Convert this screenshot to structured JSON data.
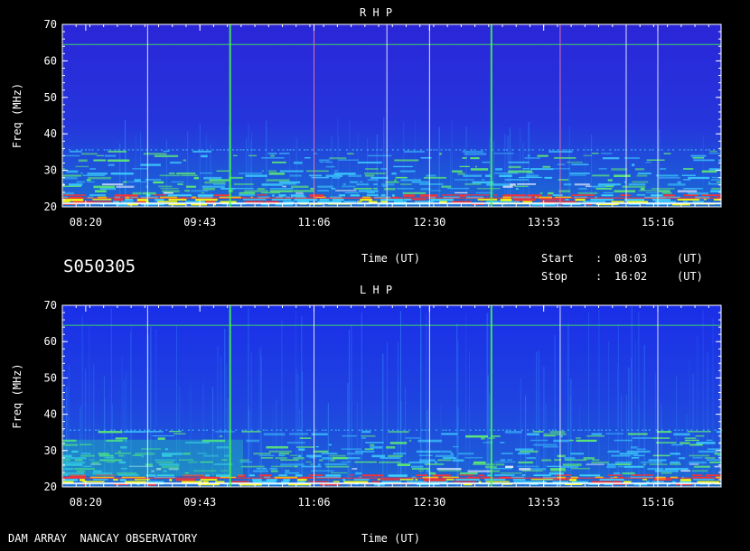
{
  "footer": {
    "observatory": "DAM ARRAY  NANCAY OBSERVATORY",
    "time_label": "Time (UT)"
  },
  "header_info": {
    "observation_id": "S050305",
    "time_label": "Time (UT)",
    "start_label": "Start",
    "start_value": "08:03",
    "stop_label": "Stop",
    "stop_value": "16:02",
    "separator": ":",
    "unit": "(UT)"
  },
  "colors": {
    "background": "#000000",
    "spectrum_base": "#1a24e0",
    "spectrum_high": "#2a4bd0",
    "noise_cyan": "#3fd6ff",
    "noise_green": "#66ff66",
    "hot_red": "#ff3030",
    "hot_yellow": "#ffff00",
    "green_marker": "#44ff44"
  },
  "chart_data": [
    {
      "type": "heatmap",
      "title": "R H P",
      "ylabel": "Freq (MHz)",
      "xlabel": "",
      "ylim": [
        20,
        70
      ],
      "y_ticks": [
        "20",
        "30",
        "40",
        "50",
        "60",
        "70"
      ],
      "y_tick_values": [
        20,
        30,
        40,
        50,
        60,
        70
      ],
      "xlim": [
        "08:03",
        "16:02"
      ],
      "x_ticks": [
        "08:20",
        "09:43",
        "11:06",
        "12:30",
        "13:53",
        "15:16"
      ],
      "x_tick_times": [
        "08:20",
        "09:43",
        "11:06",
        "12:30",
        "13:53",
        "15:16"
      ],
      "vertical_markers": [
        {
          "time": "09:05",
          "color": "white"
        },
        {
          "time": "10:05",
          "color": "green"
        },
        {
          "time": "11:06",
          "color": "pink"
        },
        {
          "time": "11:59",
          "color": "white"
        },
        {
          "time": "12:30",
          "color": "white"
        },
        {
          "time": "13:15",
          "color": "green"
        },
        {
          "time": "14:05",
          "color": "pink"
        },
        {
          "time": "14:53",
          "color": "white"
        },
        {
          "time": "15:16",
          "color": "white"
        }
      ],
      "horizontal_lines": [
        {
          "freq": 64.5,
          "color": "green"
        }
      ]
    },
    {
      "type": "heatmap",
      "title": "L H P",
      "ylabel": "Freq (MHz)",
      "xlabel": "Time (UT)",
      "ylim": [
        20,
        70
      ],
      "y_ticks": [
        "20",
        "30",
        "40",
        "50",
        "60",
        "70"
      ],
      "y_tick_values": [
        20,
        30,
        40,
        50,
        60,
        70
      ],
      "xlim": [
        "08:03",
        "16:02"
      ],
      "x_ticks": [
        "08:20",
        "09:43",
        "11:06",
        "12:30",
        "13:53",
        "15:16"
      ],
      "x_tick_times": [
        "08:20",
        "09:43",
        "11:06",
        "12:30",
        "13:53",
        "15:16"
      ],
      "vertical_markers": [
        {
          "time": "09:05",
          "color": "white"
        },
        {
          "time": "10:05",
          "color": "green"
        },
        {
          "time": "11:06",
          "color": "white"
        },
        {
          "time": "12:30",
          "color": "white"
        },
        {
          "time": "13:15",
          "color": "green"
        },
        {
          "time": "14:05",
          "color": "white"
        },
        {
          "time": "15:16",
          "color": "white"
        }
      ],
      "horizontal_lines": [
        {
          "freq": 64.5,
          "color": "green"
        }
      ]
    }
  ]
}
